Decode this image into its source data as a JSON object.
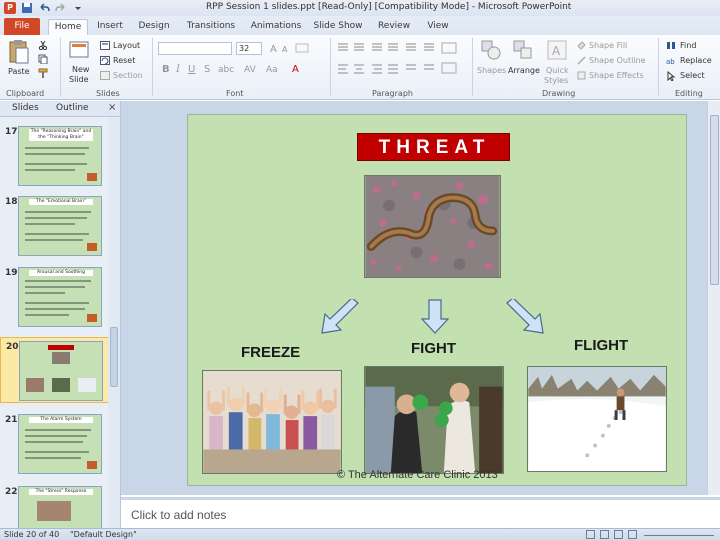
{
  "window": {
    "title": "RPP Session 1 slides.ppt [Read-Only] [Compatibility Mode] - Microsoft PowerPoint",
    "app_letter": "P"
  },
  "ribbon_tabs": [
    "File",
    "Home",
    "Insert",
    "Design",
    "Transitions",
    "Animations",
    "Slide Show",
    "Review",
    "View"
  ],
  "ribbon": {
    "clipboard": {
      "paste": "Paste",
      "label": "Clipboard"
    },
    "slides": {
      "new_slide_1": "New",
      "new_slide_2": "Slide",
      "layout": "Layout",
      "reset": "Reset",
      "section": "Section",
      "label": "Slides"
    },
    "font": {
      "size": "32",
      "label": "Font"
    },
    "paragraph": {
      "label": "Paragraph"
    },
    "drawing": {
      "shapes": "Shapes",
      "arrange": "Arrange",
      "quick_styles_1": "Quick",
      "quick_styles_2": "Styles",
      "shape_fill": "Shape Fill",
      "shape_outline": "Shape Outline",
      "shape_effects": "Shape Effects",
      "label": "Drawing"
    },
    "editing": {
      "find": "Find",
      "replace": "Replace",
      "select": "Select",
      "label": "Editing"
    }
  },
  "slides_pane": {
    "tabs": [
      "Slides",
      "Outline"
    ],
    "close": "×",
    "thumbnails": [
      {
        "num": "17",
        "title": "The \"Reasoning Brain\" and the \"Thinking Brain\""
      },
      {
        "num": "18",
        "title": "The \"Emotional Brain\""
      },
      {
        "num": "19",
        "title": "Arousal and Soothing"
      },
      {
        "num": "20",
        "title": "THREAT"
      },
      {
        "num": "21",
        "title": "The Alarm System"
      },
      {
        "num": "22",
        "title": "The \"Stress\" Response"
      }
    ]
  },
  "slide": {
    "threat": "THREAT",
    "freeze": "FREEZE",
    "fight": "FIGHT",
    "flight": "FLIGHT",
    "footer": "© The Alternate Care Clinic 2013"
  },
  "notes": {
    "placeholder": "Click to add notes"
  },
  "status": {
    "slide": "Slide 20 of 40",
    "theme": "\"Default Design\""
  },
  "colors": {
    "file_tab": "#d24726",
    "threat_box": "#c00000",
    "slide_bg": "#c3e0b1",
    "arrow_fill": "#cfe3f7"
  }
}
